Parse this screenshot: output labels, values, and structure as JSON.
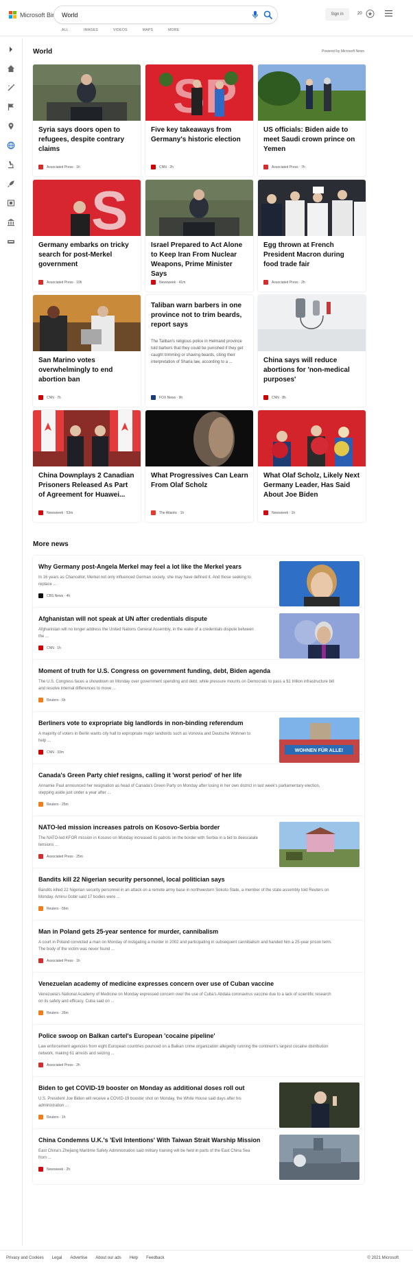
{
  "header": {
    "logo_text": "Microsoft Bing",
    "search_value": "World",
    "scopes": [
      "ALL",
      "IMAGES",
      "VIDEOS",
      "MAPS",
      "MORE"
    ],
    "signin_label": "Sign in",
    "rewards_count": "20"
  },
  "sidebar": {
    "icons": [
      "expand-icon",
      "home-icon",
      "magic-icon",
      "flag-icon",
      "location-pin-icon",
      "globe-icon",
      "microscope-icon",
      "rocket-icon",
      "film-icon",
      "bank-icon",
      "car-icon"
    ]
  },
  "world": {
    "title": "World",
    "powered_by": "Powered by Microsoft News",
    "cards": [
      {
        "title": "Syria says doors open to refugees, despite contrary claims",
        "source": "Associated Press",
        "time": "1h",
        "src_color": "#d42d2d",
        "image": "podium-green"
      },
      {
        "title": "Five key takeaways from Germany's historic election",
        "source": "CNN",
        "time": "2h",
        "src_color": "#cc0000",
        "image": "red-stage"
      },
      {
        "title": "US officials: Biden aide to meet Saudi crown prince on Yemen",
        "source": "Associated Press",
        "time": "7h",
        "src_color": "#d42d2d",
        "image": "outdoor-walk"
      },
      {
        "title": "Germany embarks on tricky search for post-Merkel government",
        "source": "Associated Press",
        "time": "10h",
        "src_color": "#d42d2d",
        "image": "red-backdrop"
      },
      {
        "title": "Israel Prepared to Act Alone to Keep Iran From Nuclear Weapons, Prime Minister Says",
        "source": "Newsweek",
        "time": "41m",
        "src_color": "#d10a10",
        "image": "podium-green"
      },
      {
        "title": "Egg thrown at French President Macron during food trade fair",
        "source": "Associated Press",
        "time": "2h",
        "src_color": "#d42d2d",
        "image": "chefs"
      },
      {
        "title": "San Marino votes overwhelmingly to end abortion ban",
        "source": "CNN",
        "time": "7h",
        "src_color": "#cc0000",
        "image": "voting"
      },
      {
        "title": "Taliban warn barbers in one province not to trim beards, report says",
        "snippet": "The Taliban's religious police in Helmand province told barbers that they could be punished if they get caught trimming or shaving beards, citing their interpretation of Sharia law, according to a ...",
        "source": "FOX News",
        "time": "9h",
        "src_color": "#1a3a7a"
      },
      {
        "title": "China says will reduce abortions for 'non-medical purposes'",
        "source": "CNN",
        "time": "8h",
        "src_color": "#cc0000",
        "image": "clinic"
      },
      {
        "title": "China Downplays 2 Canadian Prisoners Released As Part of Agreement for Huawei...",
        "source": "Newsweek",
        "time": "53m",
        "src_color": "#d10a10",
        "image": "flags"
      },
      {
        "title": "What Progressives Can Learn From Olaf Scholz",
        "source": "The Atlantic",
        "time": "1h",
        "src_color": "#e03b2c",
        "image": "portrait-dark"
      },
      {
        "title": "What Olaf Scholz, Likely Next Germany Leader, Has Said About Joe Biden",
        "source": "Newsweek",
        "time": "1h",
        "src_color": "#d10a10",
        "image": "flowers"
      }
    ]
  },
  "more_news": {
    "title": "More news",
    "items": [
      {
        "title": "Why Germany post-Angela Merkel may feel a lot like the Merkel years",
        "snippet": [
          "In 16 years as Chancellor, Merkel not only influenced German society, she may have defined it. And those seeking to",
          "replace ..."
        ],
        "source": "CBS News",
        "time": "4h",
        "src_color": "#111111",
        "image": "merkel"
      },
      {
        "title": "Afghanistan will not speak at UN after credentials dispute",
        "snippet": [
          "Afghanistan will no longer address the United Nations General Assembly, in the wake of a credentials dispute between",
          "the ..."
        ],
        "source": "CNN",
        "time": "1h",
        "src_color": "#cc0000",
        "image": "un-speaker"
      },
      {
        "title": "Moment of truth for U.S. Congress on government funding, debt, Biden agenda",
        "snippet": [
          "The U.S. Congress faces a showdown on Monday over government spending and debt, while pressure mounts on Democrats to pass a $1 trillion infrastructure bill",
          "and resolve internal differences to move ..."
        ],
        "source": "Reuters",
        "time": "6h",
        "src_color": "#f07e1a"
      },
      {
        "title": "Berliners vote to expropriate big landlords in non-binding referendum",
        "snippet": [
          "A majority of voters in Berlin wants city hall to expropriate major landlords such as Vonovia and Deutsche Wohnen to",
          "help ..."
        ],
        "source": "CNN",
        "time": "33m",
        "src_color": "#cc0000",
        "image": "protest",
        "banner_text": "WOHNEN FÜR ALLE!"
      },
      {
        "title": "Canada's Green Party chief resigns, calling it 'worst period' of her life",
        "snippet": [
          "Annamie Paul announced her resignation as head of Canada's Green Party on Monday after losing in her own district in last week's parliamentary election,",
          "stepping aside just under a year after ..."
        ],
        "source": "Reuters",
        "time": "25m",
        "src_color": "#f07e1a"
      },
      {
        "title": "NATO-led mission increases patrols on Kosovo-Serbia border",
        "snippet": [
          "The NATO-led KFOR mission in Kosovo on Monday increased its patrols on the border with Serbia in a bid to deescalate",
          "tensions ..."
        ],
        "source": "Associated Press",
        "time": "25m",
        "src_color": "#d42d2d",
        "image": "kosovo"
      },
      {
        "title": "Bandits kill 22 Nigerian security personnel, local politician says",
        "snippet": [
          "Bandits killed 22 Nigerian security personnel in an attack on a remote army base in northwestern Sokoto State, a member of the state assembly told Reuters on",
          "Monday. Aminu Gobir said 17 bodies were ..."
        ],
        "source": "Reuters",
        "time": "56m",
        "src_color": "#f07e1a"
      },
      {
        "title": "Man in Poland gets 25-year sentence for murder, cannibalism",
        "snippet": [
          "A court in Poland convicted a man on Monday of instigating a murder in 2002 and participating in subsequent cannibalism and handed him a 25-year prison term.",
          "The body of the victim was never found ..."
        ],
        "source": "Associated Press",
        "time": "1h",
        "src_color": "#d42d2d"
      },
      {
        "title": "Venezuelan academy of medicine expresses concern over use of Cuban vaccine",
        "snippet": [
          "Venezuela's National Academy of Medicine on Monday expressed concern over the use of Cuba's Abdala coronavirus vaccine due to a lack of scientific research",
          "on its safety and efficacy. Cuba said on ..."
        ],
        "source": "Reuters",
        "time": "26m",
        "src_color": "#f07e1a"
      },
      {
        "title": "Police swoop on Balkan cartel's European 'cocaine pipeline'",
        "snippet": [
          "Law enforcement agencies from eight European countries pounced on a Balkan crime organization allegedly running the continent's largest cocaine distribution",
          "network, making 61 arrests and seizing ..."
        ],
        "source": "Associated Press",
        "time": "2h",
        "src_color": "#d42d2d"
      },
      {
        "title": "Biden to get COVID-19 booster on Monday as additional doses roll out",
        "snippet": [
          "U.S. President Joe Biden will receive a COVID-19 booster shot on Monday, the White House said days after his",
          "administration ..."
        ],
        "source": "Reuters",
        "time": "1h",
        "src_color": "#f07e1a",
        "image": "biden-dark"
      },
      {
        "title": "China Condemns U.K.'s 'Evil Intentions' With Taiwan Strait Warship Mission",
        "snippet": [
          "East China's Zhejiang Maritime Safety Administration said military training will be held in parts of the East China Sea",
          "from ..."
        ],
        "source": "Newsweek",
        "time": "2h",
        "src_color": "#d10a10",
        "image": "warship"
      }
    ]
  },
  "footer": {
    "links": [
      "Privacy and Cookies",
      "Legal",
      "Advertise",
      "About our ads",
      "Help",
      "Feedback"
    ],
    "copyright": "© 2021 Microsoft"
  }
}
